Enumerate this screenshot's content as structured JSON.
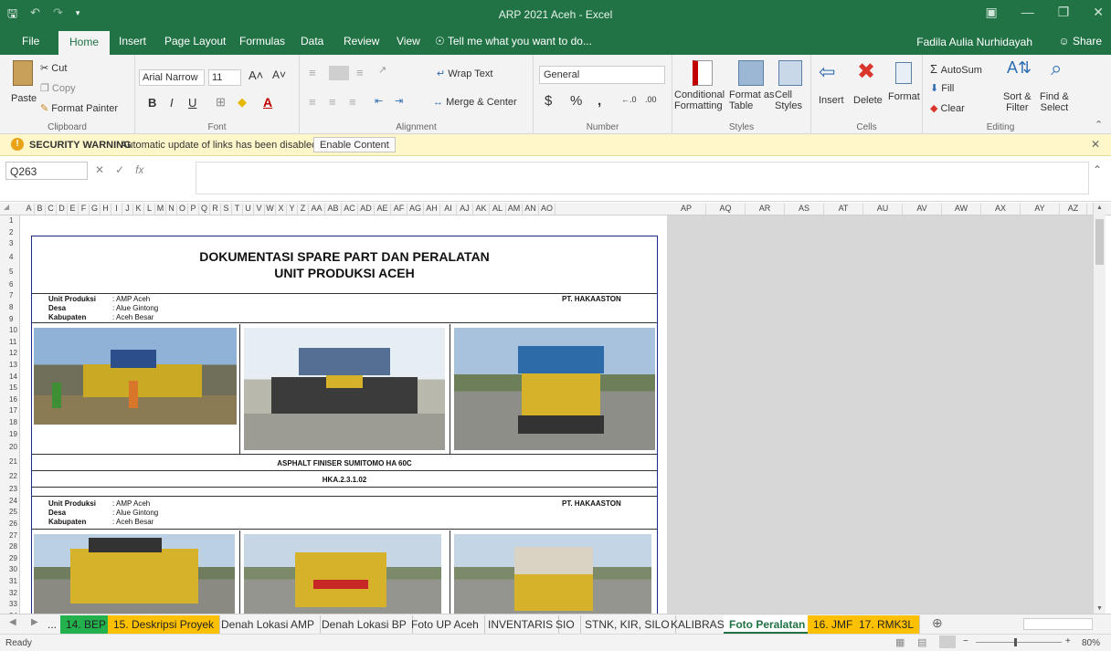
{
  "window": {
    "title": "ARP 2021 Aceh - Excel",
    "user": "Fadila Aulia Nurhidayah",
    "share": "Share"
  },
  "menu_tabs": [
    "File",
    "Home",
    "Insert",
    "Page Layout",
    "Formulas",
    "Data",
    "Review",
    "View"
  ],
  "tell_me": "Tell me what you want to do...",
  "ribbon": {
    "clipboard": {
      "label": "Clipboard",
      "paste": "Paste",
      "cut": "Cut",
      "copy": "Copy",
      "format_painter": "Format Painter"
    },
    "font": {
      "label": "Font",
      "family": "Arial Narrow",
      "size": "11"
    },
    "alignment": {
      "label": "Alignment",
      "wrap_text": "Wrap Text",
      "merge_center": "Merge & Center"
    },
    "number": {
      "label": "Number",
      "format": "General"
    },
    "styles": {
      "label": "Styles",
      "conditional": "Conditional",
      "conditional2": "Formatting",
      "format_as": "Format as",
      "format_as2": "Table",
      "cell": "Cell",
      "cell2": "Styles"
    },
    "cells": {
      "label": "Cells",
      "insert": "Insert",
      "delete": "Delete",
      "format": "Format"
    },
    "editing": {
      "label": "Editing",
      "autosum": "AutoSum",
      "fill": "Fill",
      "clear": "Clear",
      "sort": "Sort &",
      "sort2": "Filter",
      "find": "Find &",
      "find2": "Select"
    }
  },
  "security": {
    "title": "SECURITY WARNING",
    "message": "Automatic update of links has been disabled",
    "button": "Enable Content"
  },
  "formula": {
    "namebox": "Q263",
    "fx": "fx"
  },
  "columns_narrow": [
    "A",
    "B",
    "C",
    "D",
    "E",
    "F",
    "G",
    "H",
    "I",
    "J",
    "K",
    "L",
    "M",
    "N",
    "O",
    "P",
    "Q",
    "R",
    "S",
    "T",
    "U",
    "V",
    "W",
    "X",
    "Y",
    "Z",
    "AA",
    "AB",
    "AC",
    "AD",
    "AE",
    "AF",
    "AG",
    "AH",
    "AI",
    "AJ",
    "AK",
    "AL",
    "AM",
    "AN",
    "AO"
  ],
  "columns_wide": [
    "AP",
    "AQ",
    "AR",
    "AS",
    "AT",
    "AU",
    "AV",
    "AW",
    "AX",
    "AY",
    "AZ"
  ],
  "rows": [
    "1",
    "2",
    "3",
    "4",
    "5",
    "6",
    "7",
    "8",
    "9",
    "10",
    "11",
    "12",
    "13",
    "14",
    "15",
    "16",
    "17",
    "18",
    "19",
    "20",
    "21",
    "22",
    "23",
    "24",
    "25",
    "26",
    "27",
    "28",
    "29",
    "30",
    "31",
    "32",
    "33",
    "34"
  ],
  "document": {
    "title1": "DOKUMENTASI SPARE PART DAN PERALATAN",
    "title2": "UNIT PRODUKSI ACEH",
    "block1": {
      "unit_label": "Unit Produksi",
      "unit_value": ": AMP Aceh",
      "desa_label": "Desa",
      "desa_value": ": Alue Gintong",
      "kab_label": "Kabupaten",
      "kab_value": ": Aceh Besar",
      "company": "PT. HAKAASTON",
      "caption": "ASPHALT FINISER SUMITOMO HA 60C",
      "code": "HKA.2.3.1.02"
    },
    "block2": {
      "unit_label": "Unit Produksi",
      "unit_value": ": AMP Aceh",
      "desa_label": "Desa",
      "desa_value": ": Alue Gintong",
      "kab_label": "Kabupaten",
      "kab_value": ": Aceh Besar",
      "company": "PT. HAKAASTON"
    }
  },
  "sheet_tabs": [
    {
      "label": "...",
      "color": "#f3f3f3"
    },
    {
      "label": "14. BEP",
      "color": "#22b14c"
    },
    {
      "label": "15. Deskripsi Proyek",
      "color": "#ffc000"
    },
    {
      "label": "Denah Lokasi AMP",
      "color": "#f3f3f3"
    },
    {
      "label": "Denah Lokasi BP",
      "color": "#f3f3f3"
    },
    {
      "label": "Foto UP Aceh",
      "color": "#f3f3f3"
    },
    {
      "label": "INVENTARIS",
      "color": "#f3f3f3"
    },
    {
      "label": "SIO",
      "color": "#f3f3f3"
    },
    {
      "label": "STNK, KIR, SILO",
      "color": "#f3f3f3"
    },
    {
      "label": "KALIBRASI",
      "color": "#f3f3f3"
    },
    {
      "label": "Foto Peralatan",
      "color": "#ffffff"
    },
    {
      "label": "16. JMF",
      "color": "#ffc000"
    },
    {
      "label": "17. RMK3L",
      "color": "#ffc000"
    }
  ],
  "status": {
    "ready": "Ready",
    "zoom": "80%"
  }
}
